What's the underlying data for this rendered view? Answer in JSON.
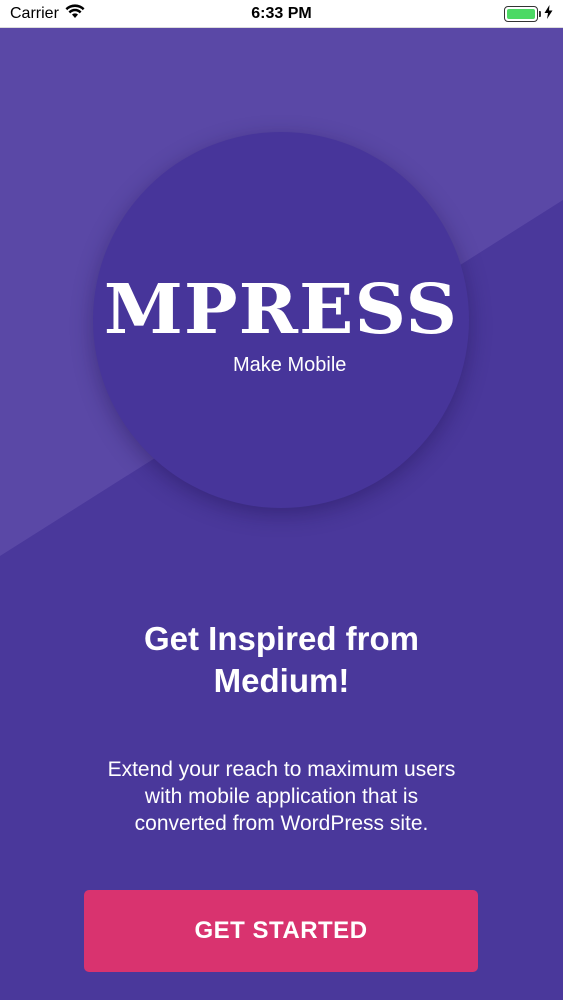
{
  "status_bar": {
    "carrier": "Carrier",
    "time": "6:33 PM",
    "wifi_icon": "wifi-icon",
    "battery_icon": "battery-icon",
    "charging_icon": "bolt-icon",
    "battery_level": 1.0
  },
  "colors": {
    "background": "#4a389b",
    "background_light": "#5a48a6",
    "circle": "#47359a",
    "button": "#d9336f",
    "text": "#ffffff",
    "battery": "#4cd964"
  },
  "logo": {
    "title": "MPRESS",
    "subtitle": "Make Mobile"
  },
  "headline": {
    "line1": "Get Inspired from",
    "line2": "Medium!"
  },
  "description": {
    "line1": "Extend your reach to maximum users",
    "line2": "with mobile application that is",
    "line3": "converted from WordPress site."
  },
  "cta": {
    "label": "GET STARTED"
  }
}
